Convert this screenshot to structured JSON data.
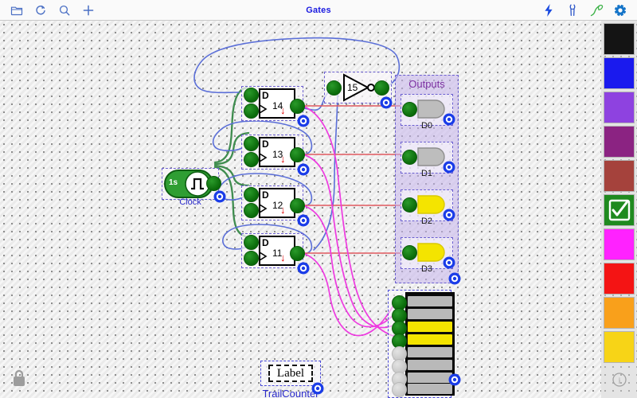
{
  "window": {
    "title": "Gates"
  },
  "toolbar": {
    "left": [
      {
        "name": "folder-icon",
        "label": "Open"
      },
      {
        "name": "refresh-icon",
        "label": "Reload"
      },
      {
        "name": "search-icon",
        "label": "Search"
      },
      {
        "name": "plus-icon",
        "label": "Add"
      }
    ],
    "right": [
      {
        "name": "lightning-icon",
        "label": "Power"
      },
      {
        "name": "pliers-icon",
        "label": "Tools"
      },
      {
        "name": "probe-icon",
        "label": "Probe"
      },
      {
        "name": "gear-icon",
        "label": "Settings"
      }
    ]
  },
  "palette": {
    "swatches": [
      {
        "name": "swatch-black",
        "color": "#141414",
        "selected": false
      },
      {
        "name": "swatch-blue",
        "color": "#1a1aee",
        "selected": false
      },
      {
        "name": "swatch-violet",
        "color": "#8e42e0",
        "selected": false
      },
      {
        "name": "swatch-purple",
        "color": "#8b2382",
        "selected": false
      },
      {
        "name": "swatch-brick",
        "color": "#a5423c",
        "selected": false
      },
      {
        "name": "swatch-green",
        "color": "#1f8a1f",
        "selected": true
      },
      {
        "name": "swatch-magenta",
        "color": "#ff22ff",
        "selected": false
      },
      {
        "name": "swatch-red",
        "color": "#f41414",
        "selected": false
      },
      {
        "name": "swatch-orange",
        "color": "#f9a01b",
        "selected": false
      },
      {
        "name": "swatch-yellow",
        "color": "#f7d417",
        "selected": false
      }
    ],
    "info_label": "i"
  },
  "canvas": {
    "clock": {
      "rate": "1s",
      "label": "Clock",
      "glyph": "square-wave"
    },
    "inverter": {
      "number": "15",
      "label": ""
    },
    "flipflops": [
      {
        "number": "14",
        "type": "D"
      },
      {
        "number": "13",
        "type": "D"
      },
      {
        "number": "12",
        "type": "D"
      },
      {
        "number": "11",
        "type": "D"
      }
    ],
    "outputs": {
      "title": "Outputs",
      "leds": [
        {
          "name": "D0",
          "state": "off"
        },
        {
          "name": "D1",
          "state": "off"
        },
        {
          "name": "D2",
          "state": "on"
        },
        {
          "name": "D3",
          "state": "on"
        }
      ]
    },
    "bargraph": {
      "segments": [
        "off",
        "off",
        "on",
        "on",
        "off",
        "off",
        "off",
        "off"
      ],
      "connected_inputs": 4,
      "total_inputs": 8
    },
    "label_component": {
      "text": "Label",
      "caption": "TrailCounter"
    },
    "lock": {
      "name": "lock-icon",
      "state": "locked"
    }
  },
  "colors": {
    "wire_clock": "#3f8d4f",
    "wire_feedback": "#5b6fd8",
    "wire_led": "#e0595f",
    "wire_bargraph": "#ee3ae0",
    "led_on": "#f4e400",
    "led_off": "#b9b9b9",
    "accent_blue": "#1a1ae0",
    "group_purple": "#7b2fa0"
  }
}
